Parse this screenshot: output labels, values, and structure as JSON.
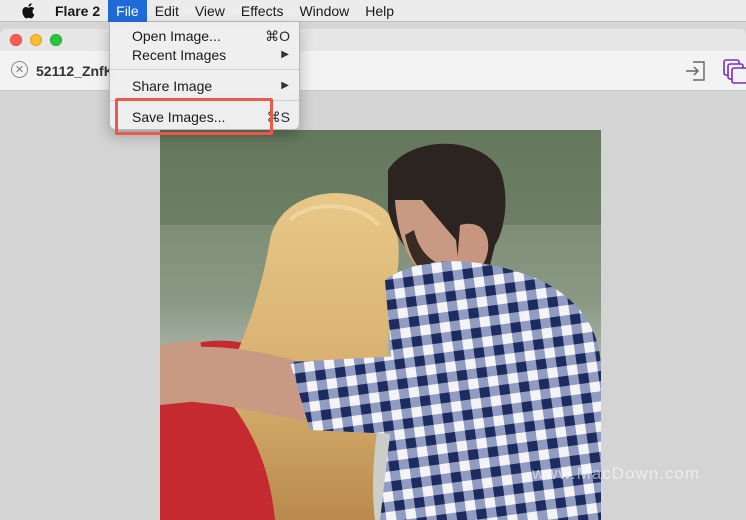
{
  "menubar": {
    "apple_icon": "apple-logo-icon",
    "app_name": "Flare 2",
    "menus": [
      "File",
      "Edit",
      "View",
      "Effects",
      "Window",
      "Help"
    ],
    "active_menu": "File"
  },
  "file_menu": {
    "items": [
      {
        "label": "Open Image...",
        "shortcut": "⌘O"
      },
      {
        "label": "Recent Images",
        "submenu": "▶"
      },
      {
        "label": "Share Image",
        "submenu": "▶"
      },
      {
        "label": "Save Images...",
        "shortcut": "⌘S"
      }
    ],
    "highlighted_item": "Save Images..."
  },
  "tab": {
    "title": "52112_ZnfK",
    "close_icon": "close-circle-icon"
  },
  "toolbar": {
    "export_icon": "export-icon",
    "layers_icon": "layers-icon"
  },
  "watermark": "www.MacDown.com",
  "colors": {
    "menu_highlight": "#1f6ad6",
    "annotation_red": "#e85a4f",
    "layers_accent": "#7b2fbe"
  }
}
